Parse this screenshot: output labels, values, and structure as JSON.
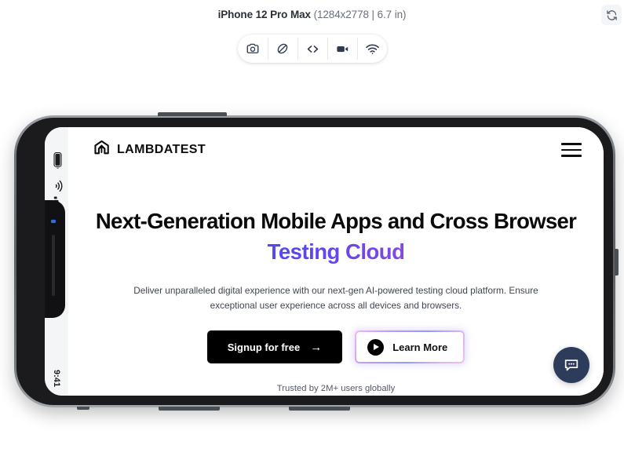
{
  "topbar": {
    "device_name": "iPhone 12 Pro Max",
    "device_specs": "(1284x2778 | 6.7 in)",
    "refresh_icon": "refresh-icon"
  },
  "toolbar": {
    "items": [
      {
        "name": "screenshot-icon",
        "label": "Screenshot"
      },
      {
        "name": "rotate-orientation-icon",
        "label": "Rotate"
      },
      {
        "name": "devtools-code-icon",
        "label": "Code"
      },
      {
        "name": "record-video-icon",
        "label": "Record"
      },
      {
        "name": "network-throttle-icon",
        "label": "Network"
      }
    ]
  },
  "device": {
    "status_bar": {
      "time": "9:41",
      "battery_icon": "battery-icon",
      "wifi_icon": "wifi-icon",
      "signal_icon": "cellular-signal-icon"
    }
  },
  "page": {
    "brand": "LAMBDATEST",
    "brand_logo_icon": "lambdatest-logo-icon",
    "menu_icon": "hamburger-menu-icon",
    "hero": {
      "headline": "Next-Generation Mobile Apps and Cross Browser",
      "headline_accent": "Testing Cloud",
      "subhead": "Deliver unparalleled digital experience with our next-gen AI-powered testing cloud platform. Ensure exceptional user experience across all devices and browsers.",
      "primary_cta": "Signup for free",
      "primary_cta_arrow": "→",
      "secondary_cta": "Learn More",
      "secondary_cta_icon": "play-icon",
      "trusted_text": "Trusted by 2M+ users globally"
    },
    "chat_icon": "chat-bubble-icon"
  },
  "colors": {
    "accent_gradient_start": "#3656fb",
    "accent_gradient_end": "#c24fd1",
    "primary_button_bg": "#000000",
    "chat_button_bg": "#2e3c5c",
    "toolbar_icon": "#2f3952"
  }
}
